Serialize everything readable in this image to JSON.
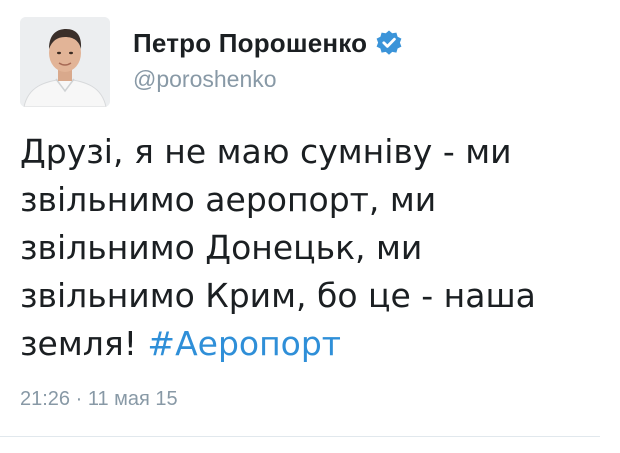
{
  "author": {
    "display_name": "Петро Порошенко",
    "handle": "@poroshenko",
    "verified": true,
    "verified_icon": "verified-badge-icon",
    "verified_color": "#3b94d9"
  },
  "tweet": {
    "lines": [
      "Друзі, я не маю сумніву - ми",
      "звільнимо аеропорт, ми",
      "звільнимо Донецьк, ми",
      "звільнимо Крим, бо це - наша"
    ],
    "last_line_text": "земля!",
    "hashtag": "#Аеропорт",
    "hashtag_color": "#2f8fd8"
  },
  "meta": {
    "timestamp": "21:26 · 11 мая 15"
  }
}
